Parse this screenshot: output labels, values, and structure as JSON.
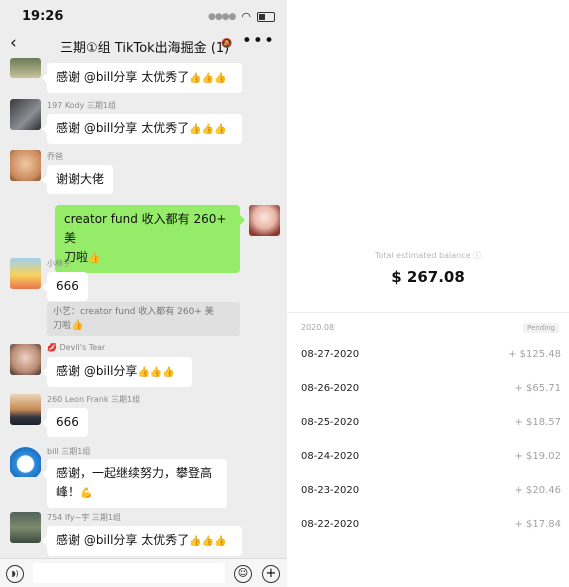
{
  "status_bar": {
    "time": "19:26"
  },
  "chat": {
    "title": "三期①组 TikTok出海掘金 (1)",
    "mute_icon": "🔕",
    "more_icon": "•••",
    "back_icon": "‹",
    "messages": [
      {
        "sender": "",
        "text": "感谢 @bill分享 太优秀了",
        "thumbs": "👍👍👍"
      },
      {
        "sender": "197 Kody 三期1组",
        "text": "感谢 @bill分享 太优秀了",
        "thumbs": "👍👍👍"
      },
      {
        "sender": "乔爸",
        "text": "谢谢大佬"
      },
      {
        "sender": "",
        "text_line1": "creator fund 收入都有 260+ 美",
        "text_line2": "刀啦",
        "thumbs": "👍"
      },
      {
        "sender": "小林子",
        "text": "666",
        "quote_line1": "小艺：creator fund 收入都有 260+ 美",
        "quote_line2": "刀啦",
        "quote_thumbs": "👍"
      },
      {
        "sender": "Devil's Tear",
        "text": "感谢 @bill分享",
        "thumbs": "👍👍👍"
      },
      {
        "sender": "260 Leon Frank 三期1组",
        "text": "666"
      },
      {
        "sender": "bill 三期1组",
        "text_line1": "感谢，一起继续努力，攀登高",
        "text_line2": "峰！",
        "thumbs": "💪"
      },
      {
        "sender": "754 Ify~宇 三期1组",
        "text": "感谢 @bill分享 太优秀了",
        "thumbs": "👍👍👍"
      }
    ],
    "input": {
      "voice_icon": "◗)",
      "emoji_icon": "☺",
      "plus_icon": "+"
    }
  },
  "earnings": {
    "balance_label": "Total estimated balance ⓘ",
    "balance": "$ 267.08",
    "month": "2020.08",
    "status": "Pending",
    "rows": [
      {
        "date": "08-27-2020",
        "amount": "+ $125.48"
      },
      {
        "date": "08-26-2020",
        "amount": "+ $65.71"
      },
      {
        "date": "08-25-2020",
        "amount": "+ $18.57"
      },
      {
        "date": "08-24-2020",
        "amount": "+ $19.02"
      },
      {
        "date": "08-23-2020",
        "amount": "+ $20.46"
      },
      {
        "date": "08-22-2020",
        "amount": "+ $17.84"
      }
    ]
  },
  "colors": {
    "self_bubble": "#95ec69",
    "chat_bg": "#ededed",
    "thumbs": "#e7a12a"
  }
}
